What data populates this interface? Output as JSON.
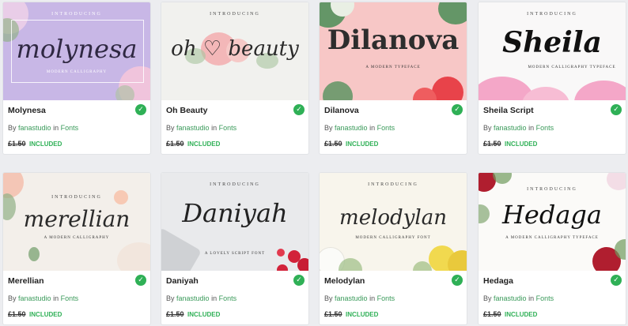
{
  "common": {
    "by_label": "By",
    "author": "fanastudio",
    "in_label": "in",
    "category": "Fonts",
    "old_price": "£1.50",
    "included_label": "INCLUDED",
    "included_icon": "checkmark-icon",
    "accent_color": "#2fb056"
  },
  "products": [
    {
      "title": "Molynesa",
      "intro": "INTRODUCING",
      "script": "molynesa",
      "sub": "MODERN CALLIGRAPHY",
      "bg": "#c8b7e6"
    },
    {
      "title": "Oh Beauty",
      "intro": "INTRODUCING",
      "script": "oh ♡ beauty",
      "sub": "",
      "bg": "#f1f1ee"
    },
    {
      "title": "Dilanova",
      "intro": "",
      "script": "Dilanova",
      "sub": "A MODERN TYPEFACE",
      "bg": "#f7c7c6"
    },
    {
      "title": "Sheila Script",
      "intro": "INTRODUCING",
      "script": "Sheila",
      "sub": "MODERN CALLIGRAPHY TYPEFACE",
      "bg": "#f9f8f8"
    },
    {
      "title": "Merellian",
      "intro": "INTRODUCING",
      "script": "merellian",
      "sub": "A MODERN CALLIGRAPHY",
      "bg": "#f3efea"
    },
    {
      "title": "Daniyah",
      "intro": "INTRODUCING",
      "script": "Daniyah",
      "sub": "A LOVELY SCRIPT FONT",
      "bg": "#e9eaec"
    },
    {
      "title": "Melodylan",
      "intro": "INTRODUCING",
      "script": "melodylan",
      "sub": "MODERN CALLIGRAPHY FONT",
      "bg": "#f8f5ec"
    },
    {
      "title": "Hedaga",
      "intro": "INTRODUCING",
      "script": "Hedaga",
      "sub": "A MODERN CALLIGRAPHY TYPEFACE",
      "bg": "#fbfaf8"
    }
  ]
}
